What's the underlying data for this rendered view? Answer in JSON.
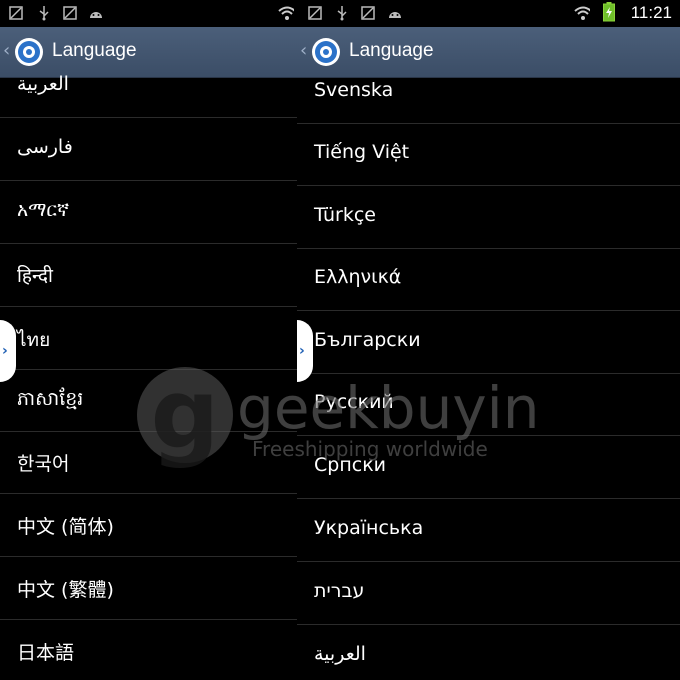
{
  "status_left": {
    "icons": [
      "image-icon",
      "usb-icon",
      "image-icon",
      "android-icon"
    ],
    "right_icons": [
      "wifi-icon"
    ]
  },
  "status_right": {
    "icons": [
      "image-icon",
      "usb-icon",
      "image-icon",
      "android-icon"
    ],
    "right_icons": [
      "wifi-icon",
      "battery-charging-icon"
    ],
    "clock": "11:21"
  },
  "left_pane": {
    "title": "Language",
    "items": [
      "العربية",
      "فارسی",
      "አማርኛ",
      "हिन्दी",
      "ไทย",
      "ភាសាខ្មែរ",
      "한국어",
      "中文 (简体)",
      "中文 (繁體)",
      "日本語"
    ]
  },
  "right_pane": {
    "title": "Language",
    "items": [
      "Svenska",
      "Tiếng Việt",
      "Türkçe",
      "Ελληνικά",
      "Български",
      "Русский",
      "Српски",
      "Українська",
      "עברית",
      "العربية"
    ]
  },
  "watermark": {
    "brand": "geekbuying",
    "tagline": "Freeshipping worldwide"
  },
  "colors": {
    "actionbar": "#43566f",
    "edge_tab": "#ffffff",
    "accent": "#1e5fb4"
  }
}
